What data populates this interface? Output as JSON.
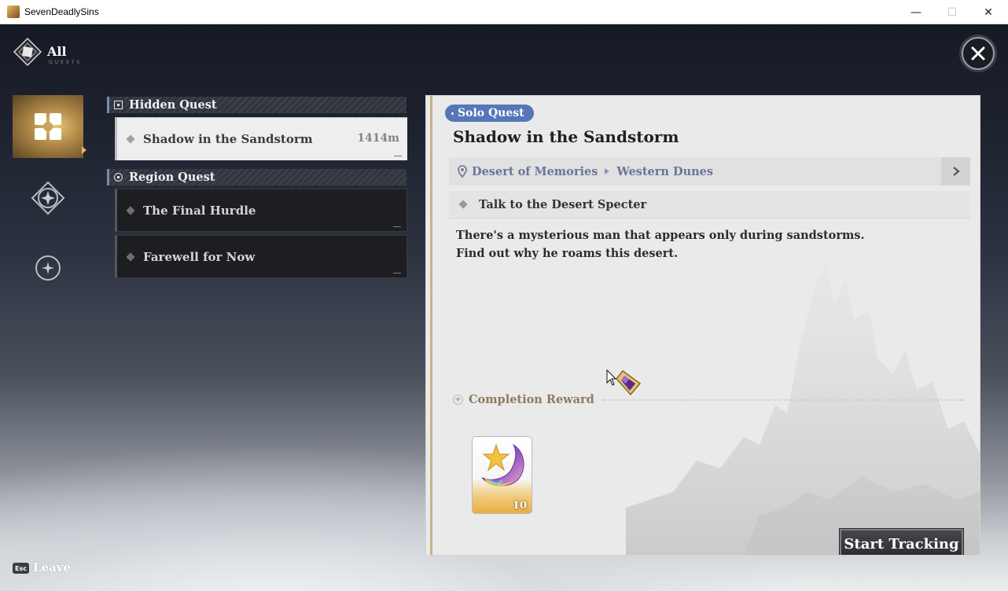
{
  "window": {
    "title": "SevenDeadlySins",
    "minimize_glyph": "—",
    "maximize_glyph": "☐",
    "close_glyph": "✕"
  },
  "header": {
    "all_label": "All",
    "all_sub": "QUESTS"
  },
  "sections": {
    "hidden": {
      "label": "Hidden Quest"
    },
    "region": {
      "label": "Region Quest"
    }
  },
  "quests": [
    {
      "title": "Shadow in the Sandstorm",
      "distance": "1414m"
    },
    {
      "title": "The Final Hurdle"
    },
    {
      "title": "Farewell for Now"
    }
  ],
  "detail": {
    "badge": "Solo Quest",
    "title": "Shadow in the Sandstorm",
    "location": {
      "region": "Desert of Memories",
      "area": "Western Dunes"
    },
    "objective": "Talk to the Desert Specter",
    "description_1": "There's a mysterious man that appears only during sandstorms.",
    "description_2": "Find out why he roams this desert.",
    "reward_label": "Completion Reward",
    "reward_quantity": "10",
    "track_button": "Start Tracking"
  },
  "footer": {
    "esc_key": "Esc",
    "leave_label": "Leave"
  },
  "colors": {
    "accent_gold": "#c8a45a",
    "badge_blue": "#5677b7",
    "location_text": "#6a759a"
  }
}
